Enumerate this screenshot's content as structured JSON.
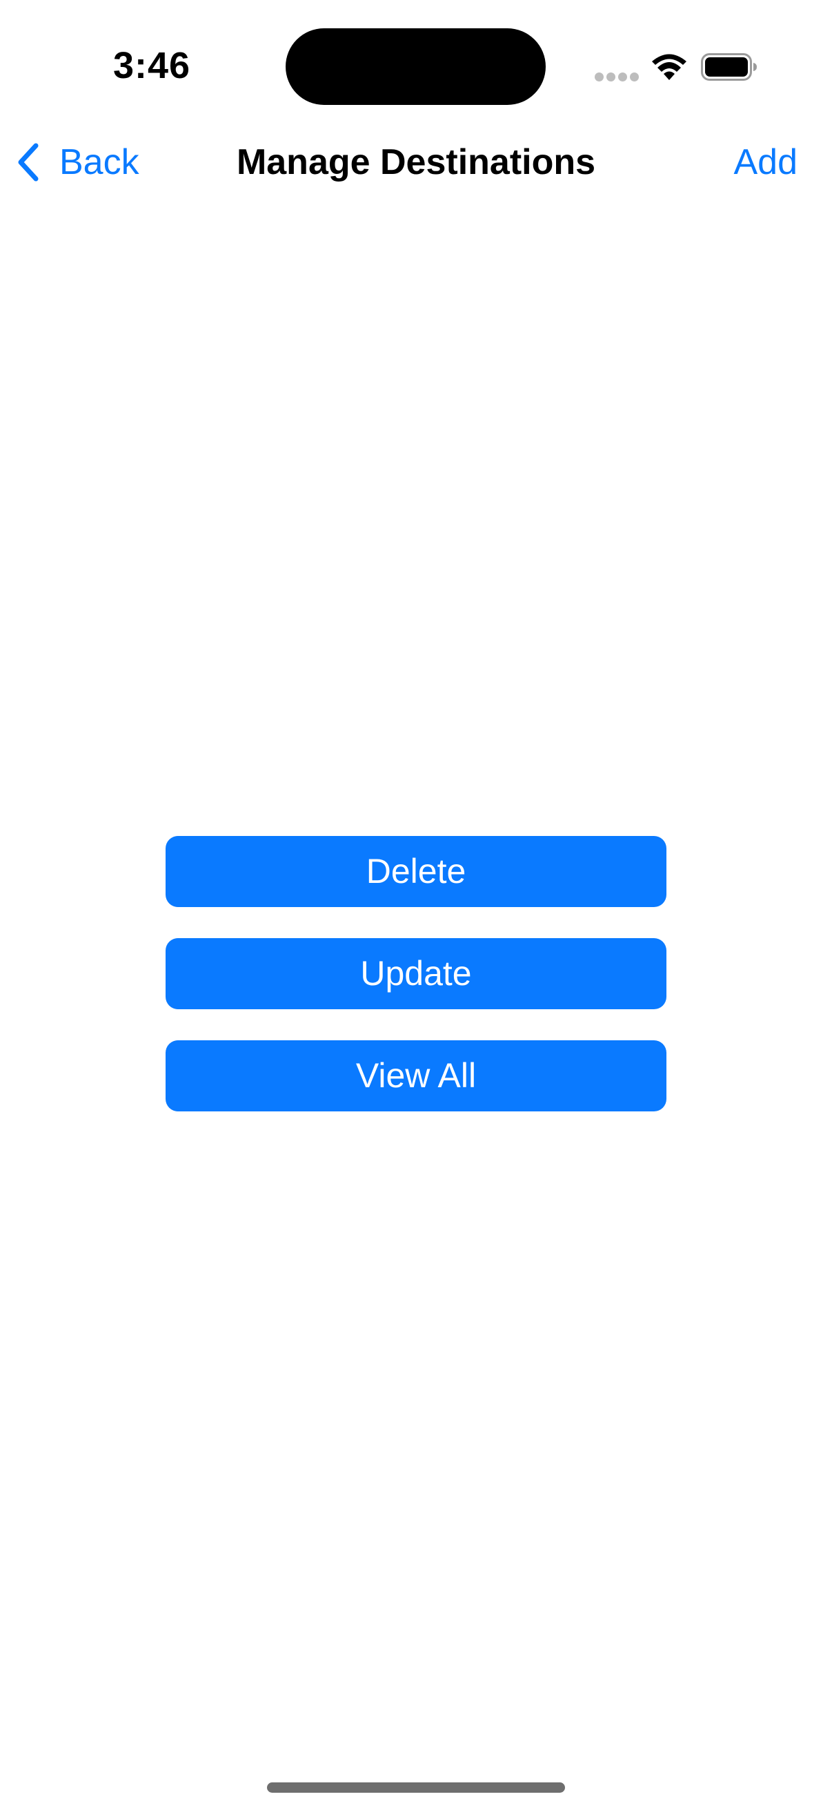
{
  "status_bar": {
    "time": "3:46",
    "icons": [
      "cellular-signal-icon",
      "wifi-icon",
      "battery-icon"
    ]
  },
  "nav": {
    "back_label": "Back",
    "title": "Manage Destinations",
    "add_label": "Add"
  },
  "actions": {
    "delete_label": "Delete",
    "update_label": "Update",
    "view_all_label": "View All"
  },
  "colors": {
    "accent": "#0a7aff",
    "background": "#ffffff",
    "button_text": "#ffffff"
  }
}
